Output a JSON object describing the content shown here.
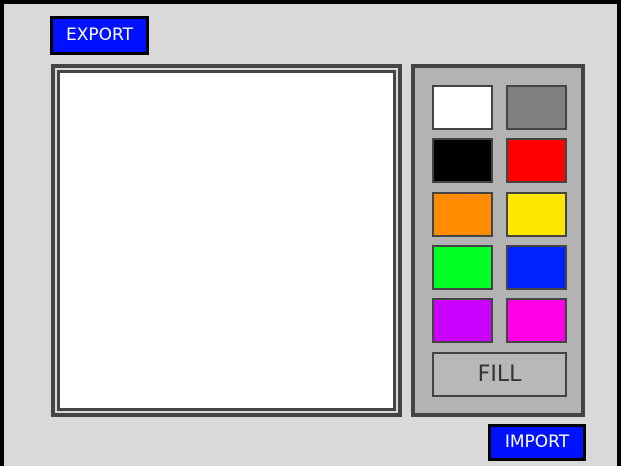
{
  "toolbar": {
    "export_label": "EXPORT",
    "import_label": "IMPORT"
  },
  "palette": {
    "swatches": [
      {
        "name": "white",
        "color": "#ffffff"
      },
      {
        "name": "gray",
        "color": "#808080"
      },
      {
        "name": "black",
        "color": "#000000"
      },
      {
        "name": "red",
        "color": "#ff0000"
      },
      {
        "name": "orange",
        "color": "#ff8c00"
      },
      {
        "name": "yellow",
        "color": "#ffe600"
      },
      {
        "name": "green",
        "color": "#00ff22"
      },
      {
        "name": "blue",
        "color": "#0022ff"
      },
      {
        "name": "purple",
        "color": "#cc00ff"
      },
      {
        "name": "magenta",
        "color": "#ff00e6"
      }
    ],
    "fill_label": "FILL"
  },
  "colors": {
    "button_blue": "#0011ff",
    "app_background": "#d9d9d9",
    "palette_background": "#b3b3b3",
    "frame_border": "#444444"
  }
}
